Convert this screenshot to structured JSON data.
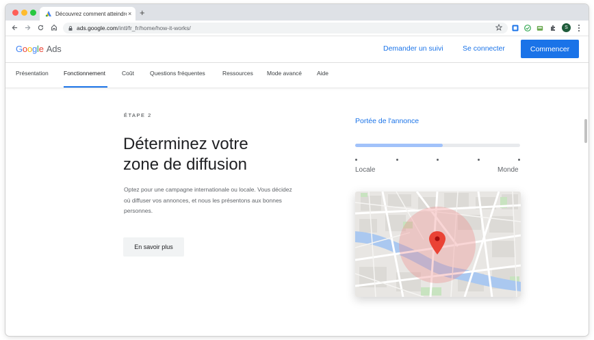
{
  "browser": {
    "tab_title": "Découvrez comment atteindre",
    "tab_close": "×",
    "new_tab": "+",
    "url_domain": "ads.google.com",
    "url_path": "/intl/fr_fr/home/how-it-works/",
    "avatar_letter": "S"
  },
  "header": {
    "logo_letters": [
      "G",
      "o",
      "o",
      "g",
      "l",
      "e"
    ],
    "logo_suffix": "Ads",
    "link_followup": "Demander un suivi",
    "link_login": "Se connecter",
    "cta_label": "Commencer",
    "accent_color": "#1a73e8"
  },
  "subnav": {
    "items": [
      "Présentation",
      "Fonctionnement",
      "Coût",
      "Questions fréquentes",
      "Ressources",
      "Mode avancé",
      "Aide"
    ],
    "active_index": 1
  },
  "content": {
    "step_label": "ÉTAPE 2",
    "heading_line1": "Déterminez votre",
    "heading_line2": "zone de diffusion",
    "paragraph": "Optez pour une campagne internationale ou locale. Vous décidez où diffuser vos annonces, et nous les présentons aux bonnes personnes.",
    "button_label": "En savoir plus"
  },
  "reach": {
    "title": "Portée de l'annonce",
    "level_fraction": 0.53,
    "min_label": "Locale",
    "max_label": "Monde",
    "tick_count": 5
  },
  "icons": {
    "back": "back-arrow-icon",
    "forward": "forward-arrow-icon",
    "reload": "reload-icon",
    "home": "home-icon",
    "lock": "lock-icon",
    "star": "bookmark-star-icon",
    "map_pin": "map-pin-icon"
  }
}
